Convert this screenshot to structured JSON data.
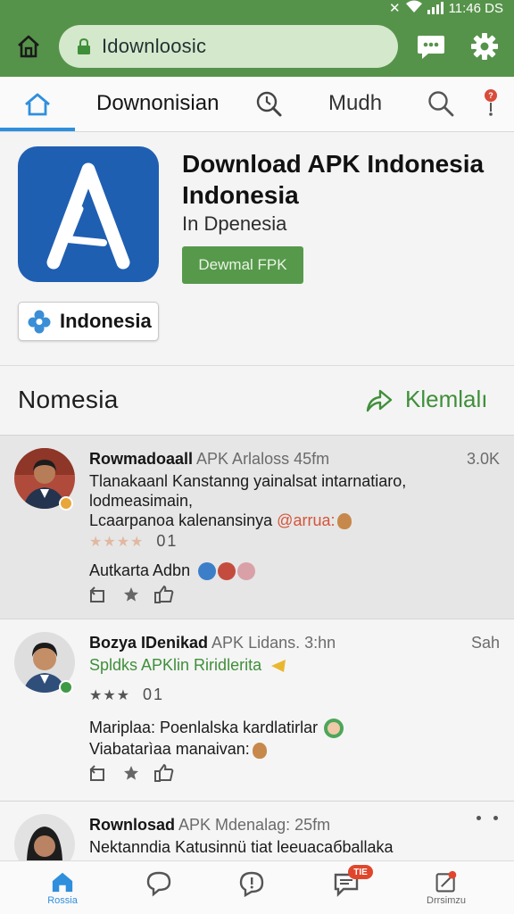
{
  "status_bar": {
    "time": "11:46 DS"
  },
  "browser": {
    "url": "Idownloosic"
  },
  "tabs": {
    "tab1_label": "Downonisian",
    "tab2_label": "Mudh"
  },
  "hero": {
    "title": "Download APK Indonesia Indonesia",
    "subtitle": "In Dpenesia",
    "download_button": "Dewmal FPK",
    "country_chip": "Indonesia"
  },
  "section": {
    "title": "Nomesia",
    "action_label": "Klemlalı"
  },
  "posts": [
    {
      "author": "Rowmadoaall",
      "meta": "APK Arlaloss 45fm",
      "count": "3.0K",
      "body_line1": "Tlanakaanl Kanstanng yainalsat intarnatiaro,",
      "body_line2": "lodmeasimain,",
      "body_line3": "Lcaarpanoa kalenansinya",
      "mention": "@arrua:",
      "rating": "01",
      "footer": "Autkarta Adbn"
    },
    {
      "author": "Bozya IDenikad",
      "meta": "APK Lidans. 3:hn",
      "count": "Sah",
      "green_line": "Spldks APKlin Riridlerita",
      "rating": "01",
      "body_line1": "Mariplaa: Poenlalska kardlatirlar",
      "body_line2": "Viabatarìaa manaivan:"
    },
    {
      "author": "Rownlosad",
      "meta": "APK Mdenalag: 25fm",
      "body_line1": "Nektanndia Katusinnü tiat leeuacaбballaka"
    }
  ],
  "bottom_nav": {
    "home_label": "Rossia",
    "badge": "TIE",
    "last_label": "Drrsimzu"
  },
  "colors": {
    "topbar": "#56934a",
    "accent_blue": "#2f8fdd",
    "accent_green": "#3f8f3a",
    "app_icon_bg": "#1f5fb2",
    "badge_red": "#e0462c"
  }
}
